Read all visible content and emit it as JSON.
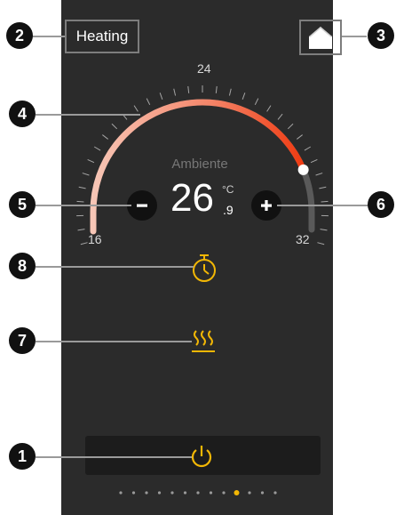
{
  "header": {
    "mode_label": "Heating"
  },
  "dial": {
    "ambient_label": "Ambiente",
    "temperature_integer": "26",
    "temperature_decimal": ".9",
    "unit": "°C",
    "min_label": "16",
    "max_label": "32",
    "top_label": "24",
    "scale_min": 16,
    "scale_max": 32,
    "setpoint": 30
  },
  "callouts": [
    "1",
    "2",
    "3",
    "4",
    "5",
    "6",
    "7",
    "8"
  ],
  "pager": {
    "count": 13,
    "active_index": 9
  },
  "colors": {
    "panel": "#2b2b2b",
    "accent": "#f2b705",
    "arc_start": "#f7c6b6",
    "arc_end": "#ef3b12",
    "track": "#5a5a5a",
    "frame": "#7d7d7d"
  },
  "icons": [
    "home-icon",
    "minus-icon",
    "plus-icon",
    "timer-icon",
    "heat-waves-icon",
    "power-icon"
  ]
}
